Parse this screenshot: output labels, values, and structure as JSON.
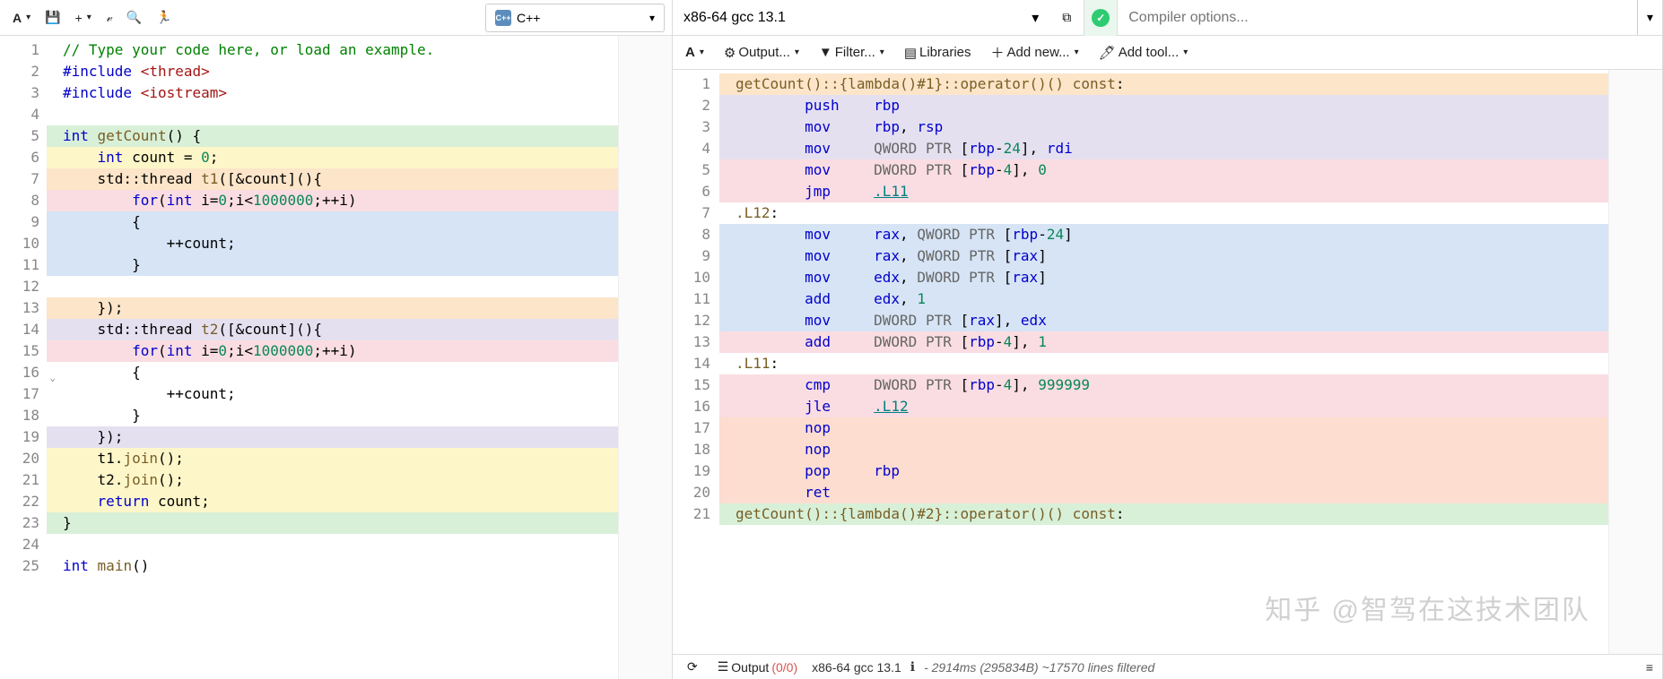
{
  "left": {
    "lang": "C++",
    "toolbar": {
      "font": "A",
      "save": "💾",
      "add": "+",
      "vim": "𝓋",
      "search": "🔍",
      "run": "🏃"
    }
  },
  "right": {
    "compiler": "x86-64 gcc 13.1",
    "options_placeholder": "Compiler options...",
    "tb2": {
      "font": "A",
      "output": "Output...",
      "filter": "Filter...",
      "libraries": "Libraries",
      "addnew": "Add new...",
      "addtool": "Add tool..."
    },
    "status": {
      "output_label": "Output",
      "output_counts": "(0/0)",
      "compiler": "x86-64 gcc 13.1",
      "timing": "- 2914ms (295834B) ~17570 lines filtered"
    }
  },
  "source_lines": [
    {
      "n": 1,
      "hl": "",
      "html": "<span class='tok-cmt'>// Type your code here, or load an example.</span>"
    },
    {
      "n": 2,
      "hl": "",
      "html": "<span class='tok-pp'>#include</span> <span class='tok-inc'>&lt;thread&gt;</span>"
    },
    {
      "n": 3,
      "hl": "",
      "html": "<span class='tok-pp'>#include</span> <span class='tok-inc'>&lt;iostream&gt;</span>"
    },
    {
      "n": 4,
      "hl": "",
      "html": ""
    },
    {
      "n": 5,
      "hl": "hl-green",
      "fold": true,
      "html": "<span class='tok-kw'>int</span> <span class='tok-fn'>getCount</span>() {"
    },
    {
      "n": 6,
      "hl": "hl-yellow",
      "html": "    <span class='tok-kw'>int</span> count = <span class='tok-num'>0</span>;"
    },
    {
      "n": 7,
      "hl": "hl-orange",
      "fold": true,
      "html": "    std::thread <span class='tok-fn'>t1</span>([&amp;count](){"
    },
    {
      "n": 8,
      "hl": "hl-pink",
      "html": "        <span class='tok-kw'>for</span>(<span class='tok-kw'>int</span> i=<span class='tok-num'>0</span>;i&lt;<span class='tok-num'>1000000</span>;++i)"
    },
    {
      "n": 9,
      "hl": "hl-blue",
      "fold": true,
      "html": "        {"
    },
    {
      "n": 10,
      "hl": "hl-blue",
      "html": "            ++count;"
    },
    {
      "n": 11,
      "hl": "hl-blue",
      "html": "        }"
    },
    {
      "n": 12,
      "hl": "",
      "html": ""
    },
    {
      "n": 13,
      "hl": "hl-orange",
      "html": "    });"
    },
    {
      "n": 14,
      "hl": "hl-lav",
      "fold": true,
      "html": "    std::thread <span class='tok-fn'>t2</span>([&amp;count](){"
    },
    {
      "n": 15,
      "hl": "hl-pink",
      "html": "        <span class='tok-kw'>for</span>(<span class='tok-kw'>int</span> i=<span class='tok-num'>0</span>;i&lt;<span class='tok-num'>1000000</span>;++i)"
    },
    {
      "n": 16,
      "hl": "",
      "fold": true,
      "html": "        {"
    },
    {
      "n": 17,
      "hl": "",
      "html": "            ++count;"
    },
    {
      "n": 18,
      "hl": "",
      "html": "        }"
    },
    {
      "n": 19,
      "hl": "hl-lav",
      "html": "    });"
    },
    {
      "n": 20,
      "hl": "hl-yellow",
      "html": "    t1.<span class='tok-fn'>join</span>();"
    },
    {
      "n": 21,
      "hl": "hl-yellow",
      "html": "    t2.<span class='tok-fn'>join</span>();"
    },
    {
      "n": 22,
      "hl": "hl-yellow",
      "html": "    <span class='tok-kw'>return</span> count;"
    },
    {
      "n": 23,
      "hl": "hl-green",
      "html": "}"
    },
    {
      "n": 24,
      "hl": "",
      "html": ""
    },
    {
      "n": 25,
      "hl": "",
      "html": "<span class='tok-kw'>int</span> <span class='tok-fn'>main</span>()"
    }
  ],
  "asm_lines": [
    {
      "n": 1,
      "hl": "hl-orange",
      "html": "<span class='tok-label'>getCount()::{lambda()#1}::operator()() const</span>:"
    },
    {
      "n": 2,
      "hl": "hl-lav",
      "html": "        <span class='tok-reg'>push</span>    <span class='tok-reg'>rbp</span>"
    },
    {
      "n": 3,
      "hl": "hl-lav",
      "html": "        <span class='tok-reg'>mov</span>     <span class='tok-reg'>rbp</span>, <span class='tok-reg'>rsp</span>"
    },
    {
      "n": 4,
      "hl": "hl-lav",
      "html": "        <span class='tok-reg'>mov</span>     <span class='tok-op'>QWORD PTR</span> [<span class='tok-reg'>rbp</span>-<span class='tok-num'>24</span>], <span class='tok-reg'>rdi</span>"
    },
    {
      "n": 5,
      "hl": "hl-pink",
      "html": "        <span class='tok-reg'>mov</span>     <span class='tok-op'>DWORD PTR</span> [<span class='tok-reg'>rbp</span>-<span class='tok-num'>4</span>], <span class='tok-num'>0</span>"
    },
    {
      "n": 6,
      "hl": "hl-pink",
      "html": "        <span class='tok-reg'>jmp</span>     <span class='tok-link'>.L11</span>"
    },
    {
      "n": 7,
      "hl": "",
      "html": "<span class='tok-label'>.L12</span>:"
    },
    {
      "n": 8,
      "hl": "hl-blue",
      "html": "        <span class='tok-reg'>mov</span>     <span class='tok-reg'>rax</span>, <span class='tok-op'>QWORD PTR</span> [<span class='tok-reg'>rbp</span>-<span class='tok-num'>24</span>]"
    },
    {
      "n": 9,
      "hl": "hl-blue",
      "html": "        <span class='tok-reg'>mov</span>     <span class='tok-reg'>rax</span>, <span class='tok-op'>QWORD PTR</span> [<span class='tok-reg'>rax</span>]"
    },
    {
      "n": 10,
      "hl": "hl-blue",
      "html": "        <span class='tok-reg'>mov</span>     <span class='tok-reg'>edx</span>, <span class='tok-op'>DWORD PTR</span> [<span class='tok-reg'>rax</span>]"
    },
    {
      "n": 11,
      "hl": "hl-blue",
      "html": "        <span class='tok-reg'>add</span>     <span class='tok-reg'>edx</span>, <span class='tok-num'>1</span>"
    },
    {
      "n": 12,
      "hl": "hl-blue",
      "html": "        <span class='tok-reg'>mov</span>     <span class='tok-op'>DWORD PTR</span> [<span class='tok-reg'>rax</span>], <span class='tok-reg'>edx</span>"
    },
    {
      "n": 13,
      "hl": "hl-pink",
      "html": "        <span class='tok-reg'>add</span>     <span class='tok-op'>DWORD PTR</span> [<span class='tok-reg'>rbp</span>-<span class='tok-num'>4</span>], <span class='tok-num'>1</span>"
    },
    {
      "n": 14,
      "hl": "",
      "html": "<span class='tok-label'>.L11</span>:"
    },
    {
      "n": 15,
      "hl": "hl-pink",
      "html": "        <span class='tok-reg'>cmp</span>     <span class='tok-op'>DWORD PTR</span> [<span class='tok-reg'>rbp</span>-<span class='tok-num'>4</span>], <span class='tok-num'>999999</span>"
    },
    {
      "n": 16,
      "hl": "hl-pink",
      "html": "        <span class='tok-reg'>jle</span>     <span class='tok-link'>.L12</span>"
    },
    {
      "n": 17,
      "hl": "hl-peach",
      "html": "        <span class='tok-reg'>nop</span>"
    },
    {
      "n": 18,
      "hl": "hl-peach",
      "html": "        <span class='tok-reg'>nop</span>"
    },
    {
      "n": 19,
      "hl": "hl-peach",
      "html": "        <span class='tok-reg'>pop</span>     <span class='tok-reg'>rbp</span>"
    },
    {
      "n": 20,
      "hl": "hl-peach",
      "html": "        <span class='tok-reg'>ret</span>"
    },
    {
      "n": 21,
      "hl": "hl-green",
      "html": "<span class='tok-label'>getCount()::{lambda()#2}::operator()() const</span>:"
    }
  ],
  "watermark": "知乎 @智驾在这技术团队"
}
